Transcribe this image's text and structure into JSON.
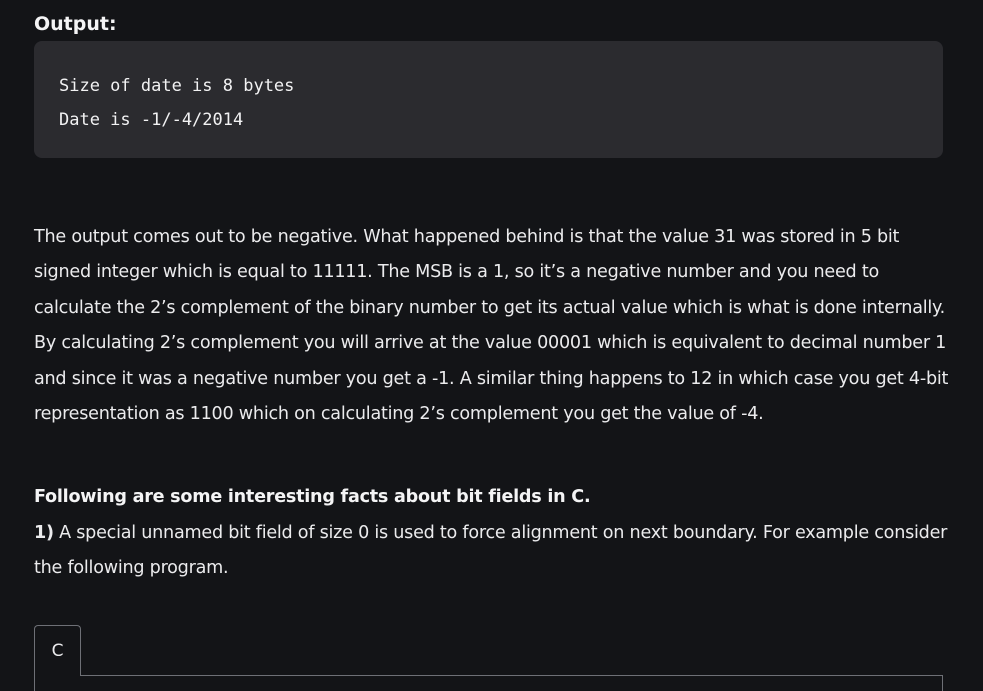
{
  "output_section": {
    "heading": "Output:",
    "lines": [
      "Size of date is 8 bytes",
      "Date is -1/-4/2014"
    ]
  },
  "explanation": {
    "paragraph": "The output comes out to be negative. What happened behind is that the value 31 was stored in 5 bit signed integer which is equal to 11111. The MSB is a 1, so it’s a negative number and you need to calculate the 2’s complement of the binary number to get its actual value which is what is done internally. By calculating 2’s complement you will arrive at the value 00001 which is equivalent to decimal number 1 and since it was a negative number you get a -1. A similar thing happens to 12 in which case you get 4-bit representation as 1100 which on calculating 2’s complement you get the value of -4."
  },
  "facts": {
    "heading": "Following are some interesting facts about bit fields in C.",
    "item1_number": "1)",
    "item1_text": " A special unnamed bit field of size 0 is used to force alignment on next boundary. For example consider the following program."
  },
  "code_block": {
    "language_tab": "C"
  }
}
